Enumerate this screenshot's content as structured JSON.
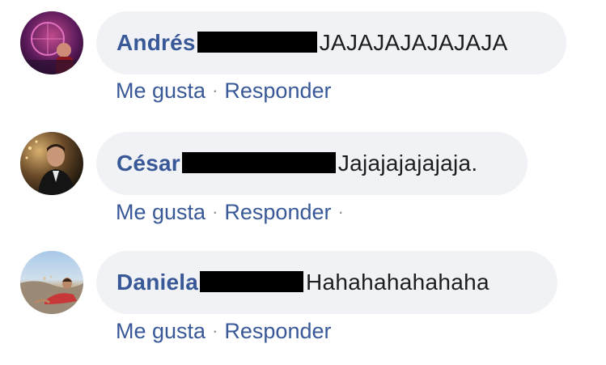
{
  "comments": [
    {
      "author": "Andrés",
      "text": "JAJAJAJAJAJAJA",
      "like_label": "Me gusta",
      "reply_label": "Responder",
      "separator": "·",
      "trailing_separator": ""
    },
    {
      "author": "César",
      "text": "Jajajajajajaja.",
      "like_label": "Me gusta",
      "reply_label": "Responder",
      "separator": "·",
      "trailing_separator": "·"
    },
    {
      "author": "Daniela",
      "text": "Hahahahahahaha",
      "like_label": "Me gusta",
      "reply_label": "Responder",
      "separator": "·",
      "trailing_separator": ""
    }
  ],
  "colors": {
    "author": "#385898",
    "link": "#385898",
    "bubble": "#f0f2f5",
    "text": "#1c1e21",
    "redaction": "#000000"
  }
}
